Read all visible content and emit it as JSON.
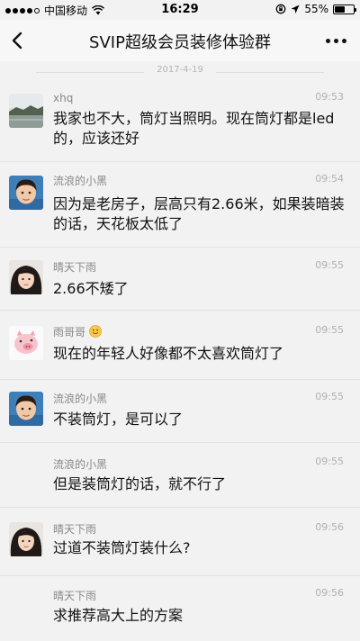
{
  "status_bar": {
    "carrier": "中国移动",
    "time": "16:29",
    "battery_percent": "55%",
    "battery_level": 0.55,
    "signal_dots": 4
  },
  "nav": {
    "title": "SVIP超级会员装修体验群"
  },
  "date_separator": "2017-4-19",
  "messages": [
    {
      "sender": "xhq",
      "time": "09:53",
      "text": "我家也不大，筒灯当照明。现在筒灯都是led的，应该还好"
    },
    {
      "sender": "流浪的小黑",
      "time": "09:54",
      "text": "因为是老房子，层高只有2.66米，如果装暗装的话，天花板太低了"
    },
    {
      "sender": "晴天下雨",
      "time": "09:55",
      "text": "2.66不矮了"
    },
    {
      "sender": "雨哥哥",
      "time": "09:55",
      "text": "现在的年轻人好像都不太喜欢筒灯了"
    },
    {
      "sender": "流浪的小黑",
      "time": "09:55",
      "text": "不装筒灯，是可以了"
    },
    {
      "sender": "流浪的小黑",
      "time": "09:55",
      "text": "但是装筒灯的话，就不行了"
    },
    {
      "sender": "晴天下雨",
      "time": "09:56",
      "text": "过道不装筒灯装什么?"
    },
    {
      "sender": "晴天下雨",
      "time": "09:56",
      "text": "求推荐高大上的方案"
    }
  ]
}
